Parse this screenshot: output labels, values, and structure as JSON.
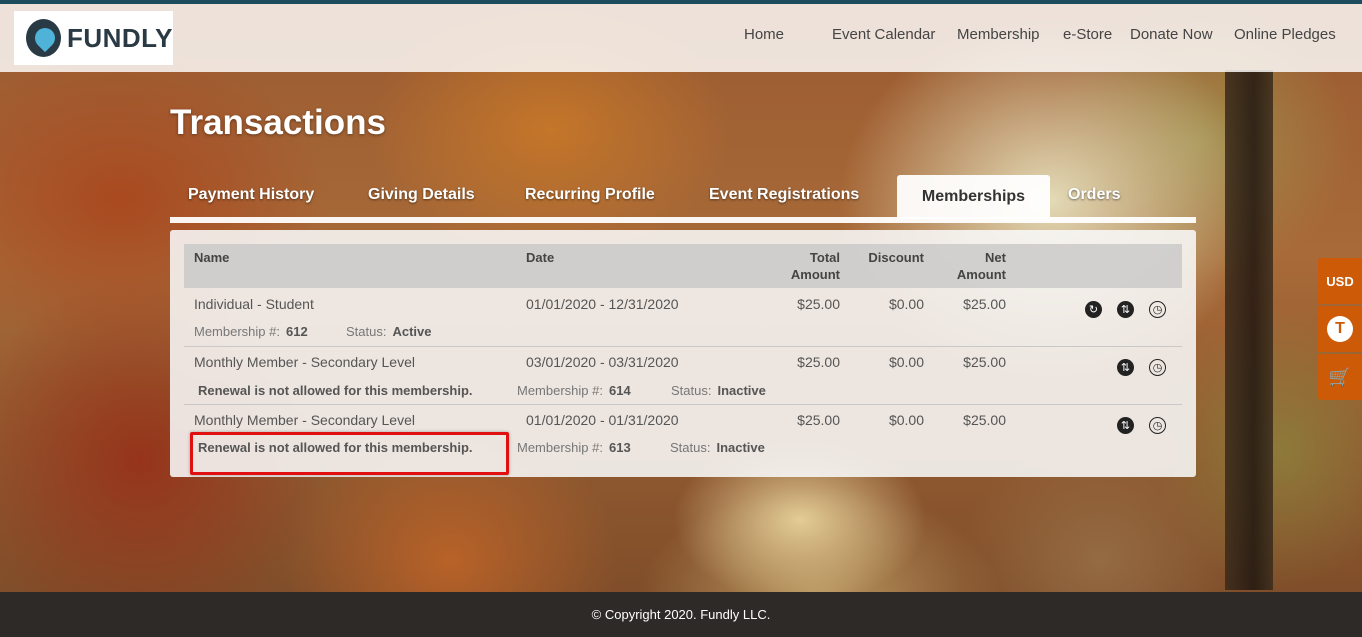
{
  "brand": {
    "name": "FUNDLY"
  },
  "nav": {
    "items": [
      "Home",
      "Event Calendar",
      "Membership",
      "e-Store",
      "Donate Now",
      "Online Pledges"
    ]
  },
  "page": {
    "title": "Transactions"
  },
  "tabs": [
    {
      "label": "Payment History",
      "active": false
    },
    {
      "label": "Giving Details",
      "active": false
    },
    {
      "label": "Recurring Profile",
      "active": false
    },
    {
      "label": "Event Registrations",
      "active": false
    },
    {
      "label": "Memberships",
      "active": true
    },
    {
      "label": "Orders",
      "active": false
    }
  ],
  "table": {
    "headers": {
      "name": "Name",
      "date": "Date",
      "total_1": "Total",
      "total_2": "Amount",
      "discount": "Discount",
      "net_1": "Net",
      "net_2": "Amount"
    },
    "labels": {
      "membership_no": "Membership #:",
      "status": "Status:"
    },
    "rows": [
      {
        "name": "Individual - Student",
        "date": "01/01/2020 - 12/31/2020",
        "total": "$25.00",
        "discount": "$0.00",
        "net": "$25.00",
        "membership_no": "612",
        "status": "Active",
        "note": ""
      },
      {
        "name": "Monthly Member - Secondary Level",
        "date": "03/01/2020 - 03/31/2020",
        "total": "$25.00",
        "discount": "$0.00",
        "net": "$25.00",
        "membership_no": "614",
        "status": "Inactive",
        "note": "Renewal is not allowed for this membership."
      },
      {
        "name": "Monthly Member - Secondary Level",
        "date": "01/01/2020 - 01/31/2020",
        "total": "$25.00",
        "discount": "$0.00",
        "net": "$25.00",
        "membership_no": "613",
        "status": "Inactive",
        "note": "Renewal is not allowed for this membership."
      }
    ]
  },
  "icons": {
    "renew": "↻",
    "transfer": "⇅",
    "history": "◷"
  },
  "side": {
    "currency": "USD",
    "t": "T",
    "cart": "🛒"
  },
  "footer": {
    "copyright": "© Copyright 2020. Fundly LLC."
  },
  "colors": {
    "accent": "#cc5a06",
    "highlight": "#e01010",
    "topbar": "#1d4c5e"
  }
}
